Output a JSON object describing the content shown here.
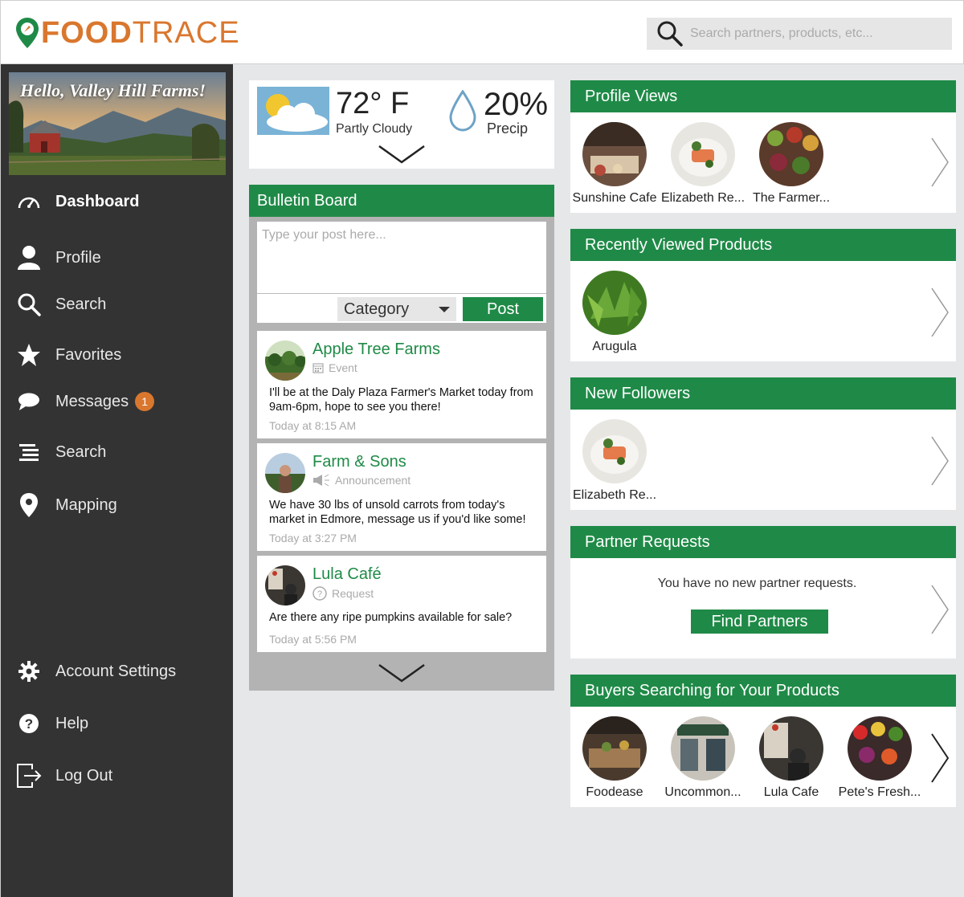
{
  "header": {
    "logo_bold": "FOOD",
    "logo_light": "TRACE",
    "search_placeholder": "Search partners, products, etc..."
  },
  "sidebar": {
    "greeting": "Hello, Valley Hill Farms!",
    "items": [
      {
        "label": "Dashboard",
        "icon": "dashboard-gauge-icon"
      },
      {
        "label": "Profile",
        "icon": "user-icon"
      },
      {
        "label": "Search",
        "icon": "search-icon"
      },
      {
        "label": "Favorites",
        "icon": "star-icon"
      },
      {
        "label": "Messages",
        "icon": "chat-bubble-icon",
        "badge": "1"
      },
      {
        "label": "Search",
        "icon": "list-lines-icon"
      },
      {
        "label": "Mapping",
        "icon": "map-pin-icon"
      },
      {
        "label": "Account Settings",
        "icon": "gear-icon"
      },
      {
        "label": "Help",
        "icon": "help-icon"
      },
      {
        "label": "Log Out",
        "icon": "logout-icon"
      }
    ]
  },
  "weather": {
    "temp": "72° F",
    "condition": "Partly Cloudy",
    "precip": "20%",
    "precip_label": "Precip"
  },
  "bulletin": {
    "title": "Bulletin Board",
    "post_placeholder": "Type your post here...",
    "category_label": "Category",
    "post_button": "Post",
    "posts": [
      {
        "author": "Apple Tree Farms",
        "type": "Event",
        "body": "I'll be at the Daly Plaza Farmer's Market today from 9am-6pm, hope to see you there!",
        "time": "Today at 8:15 AM"
      },
      {
        "author": "Farm & Sons",
        "type": "Announcement",
        "body": "We have 30 lbs of unsold carrots from today's market in Edmore, message us if you'd like some!",
        "time": "Today at 3:27 PM"
      },
      {
        "author": "Lula Café",
        "type": "Request",
        "body": "Are there any ripe pumpkins available for sale?",
        "time": "Today at 5:56 PM"
      }
    ]
  },
  "profile_views": {
    "title": "Profile Views",
    "people": [
      "Sunshine Cafe",
      "Elizabeth Re...",
      "The Farmer..."
    ]
  },
  "recent_products": {
    "title": "Recently Viewed Products",
    "items": [
      "Arugula"
    ]
  },
  "new_followers": {
    "title": "New Followers",
    "people": [
      "Elizabeth Re..."
    ]
  },
  "partner_requests": {
    "title": "Partner Requests",
    "message": "You have no new partner requests.",
    "button": "Find Partners"
  },
  "buyers": {
    "title": "Buyers Searching for Your Products",
    "people": [
      "Foodease",
      "Uncommon...",
      "Lula Cafe",
      "Pete's Fresh..."
    ]
  },
  "colors": {
    "green": "#1f8a47",
    "orange": "#d9772e",
    "sidebar": "#333333"
  }
}
